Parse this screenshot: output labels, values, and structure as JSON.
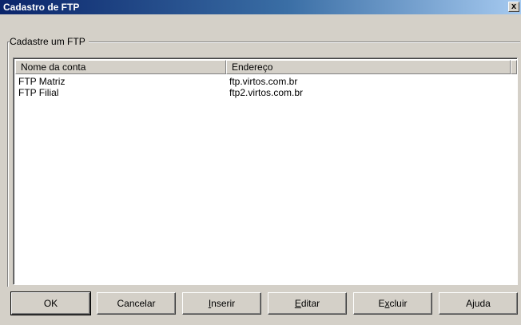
{
  "window": {
    "title": "Cadastro de FTP",
    "close_label": "x"
  },
  "group": {
    "label": "Cadastre um FTP"
  },
  "table": {
    "columns": [
      "Nome da conta",
      "Endereço"
    ],
    "rows": [
      [
        "FTP Matriz",
        "ftp.virtos.com.br"
      ],
      [
        "FTP Filial",
        "ftp2.virtos.com.br"
      ]
    ]
  },
  "buttons": [
    {
      "pre": "",
      "u": "",
      "post": "OK"
    },
    {
      "pre": "",
      "u": "",
      "post": "Cancelar"
    },
    {
      "pre": "",
      "u": "I",
      "post": "nserir"
    },
    {
      "pre": "",
      "u": "E",
      "post": "ditar"
    },
    {
      "pre": "E",
      "u": "x",
      "post": "cluir"
    },
    {
      "pre": "",
      "u": "",
      "post": "Ajuda"
    }
  ]
}
